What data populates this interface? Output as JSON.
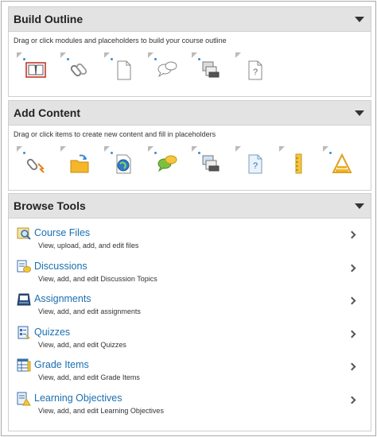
{
  "build_outline": {
    "title": "Build Outline",
    "description": "Drag or click modules and placeholders to build your course outline",
    "items": [
      "module-icon",
      "link-icon",
      "document-icon",
      "discussion-icon",
      "assignment-icon",
      "unknown-icon"
    ]
  },
  "add_content": {
    "title": "Add Content",
    "description": "Drag or click items to create new content and fill in placeholders",
    "items": [
      "attachment-icon",
      "folder-upload-icon",
      "web-link-icon",
      "discussion-icon",
      "assignment-icon",
      "unknown-icon",
      "ruler-icon",
      "checklist-icon"
    ]
  },
  "browse_tools": {
    "title": "Browse Tools",
    "tools": [
      {
        "name": "Course Files",
        "description": "View, upload, add, and edit files"
      },
      {
        "name": "Discussions",
        "description": "View, add, and edit Discussion Topics"
      },
      {
        "name": "Assignments",
        "description": "View, add, and edit assignments"
      },
      {
        "name": "Quizzes",
        "description": "View, add, and edit Quizzes"
      },
      {
        "name": "Grade Items",
        "description": "View, add, and edit Grade Items"
      },
      {
        "name": "Learning Objectives",
        "description": "View, add, and edit Learning Objectives"
      }
    ]
  }
}
